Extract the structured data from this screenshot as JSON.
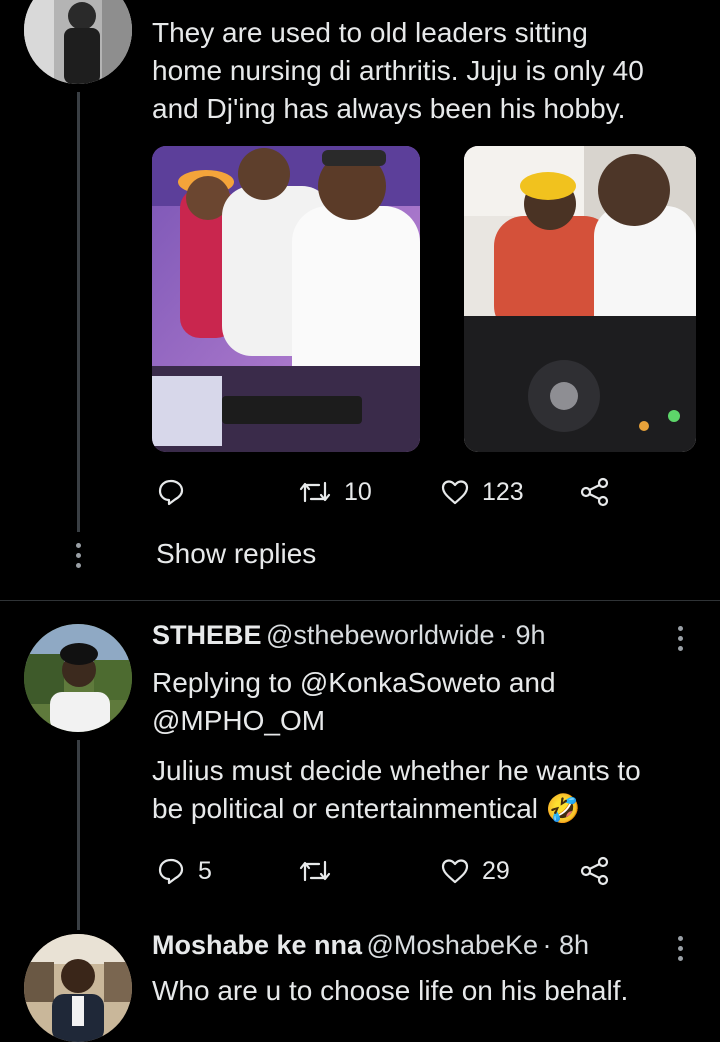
{
  "tweet1": {
    "text_line1": "They are used to old leaders sitting",
    "text_line2": "home nursing di arthritis. Juju is only 40",
    "text_line3": "and Dj'ing has always been his hobby.",
    "reply_count": "",
    "retweet_count": "10",
    "like_count": "123",
    "icons": [
      "reply-icon",
      "retweet-icon",
      "like-icon",
      "share-icon"
    ]
  },
  "show_replies": "Show replies",
  "tweet2": {
    "name": "STHEBE",
    "handle": "@sthebeworldwide",
    "time": "· 9h",
    "replying_line1": "Replying to @KonkaSoweto and",
    "replying_line2": "@MPHO_OM",
    "text_line1": "Julius must decide whether he wants to",
    "text_line2": "be political or entertainmentical",
    "emoji": "🤣",
    "reply_count": "5",
    "retweet_count": "",
    "like_count": "29"
  },
  "tweet3": {
    "name": "Moshabe ke nna",
    "handle": "@MoshabeKe",
    "time": "· 8h",
    "text_line1": "Who are u to choose life on his behalf."
  },
  "colors": {
    "background": "#000000",
    "text": "#e7e9ea",
    "divider": "#2f3336",
    "thread_line": "#3a3f44"
  }
}
